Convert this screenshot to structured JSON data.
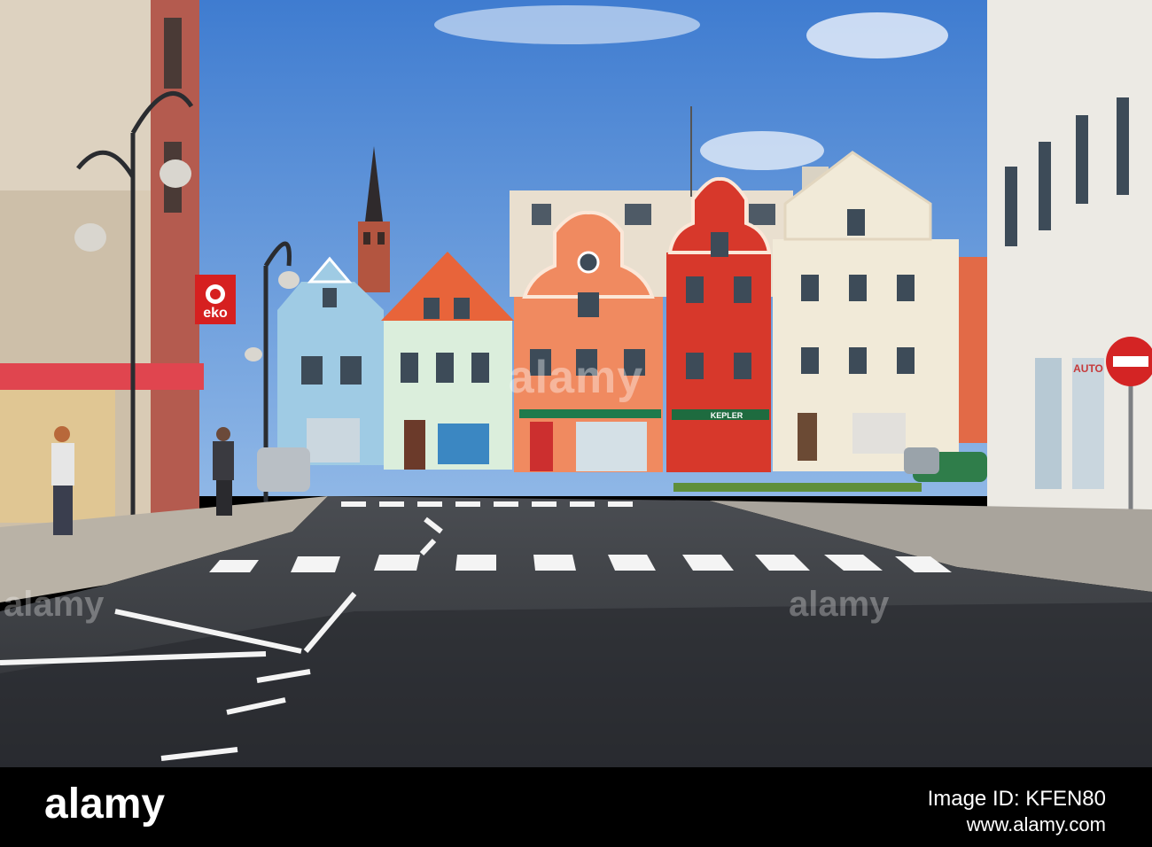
{
  "photo": {
    "subject": "Town square with colorful gabled houses",
    "signs": {
      "store_logo": "eko",
      "restaurant_sign": "KEPLER",
      "right_shop_sign": "AUTO"
    }
  },
  "watermark": {
    "center_text": "alamy",
    "left_text": "alamy",
    "right_text": "alamy"
  },
  "footer": {
    "logo_text": "alamy",
    "image_id": "Image ID: KFEN80",
    "site": "www.alamy.com"
  },
  "colors": {
    "sky": "#5b8fd6",
    "house_blue": "#9fcbe4",
    "house_mint": "#dbeedc",
    "house_salmon": "#f08a60",
    "house_red": "#d7382b",
    "house_cream": "#f1ead8",
    "road": "#3a3d42",
    "footer_bg": "#000000"
  }
}
